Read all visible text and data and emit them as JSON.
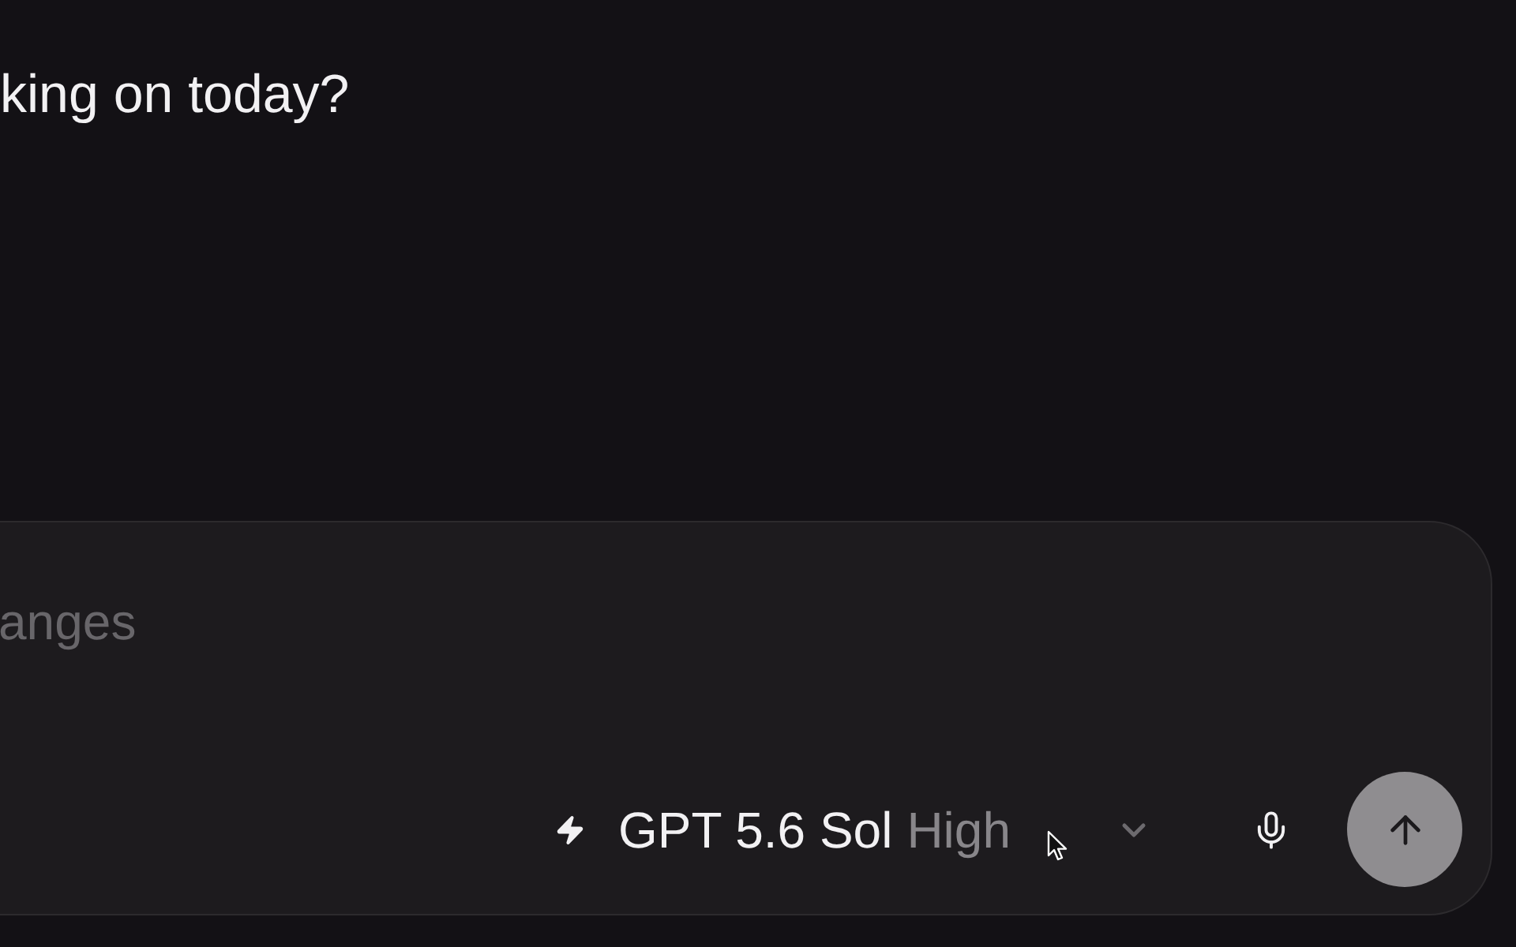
{
  "heading": "king on today?",
  "composer": {
    "placeholder": "anges",
    "model": {
      "name": "GPT 5.6 Sol",
      "effort": "High"
    },
    "send_button": {
      "disabled": true
    }
  }
}
